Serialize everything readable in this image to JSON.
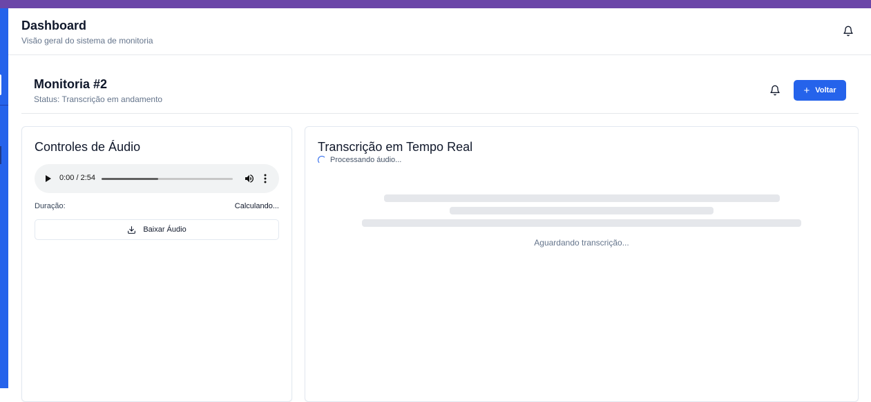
{
  "header": {
    "title": "Dashboard",
    "subtitle": "Visão geral do sistema de monitoria",
    "bell_icon": "bell-icon"
  },
  "page": {
    "title": "Monitoria #2",
    "status": "Status: Transcrição em andamento",
    "back_button": "Voltar",
    "back_button_icon": "plus-icon"
  },
  "audio_card": {
    "title": "Controles de Áudio",
    "player": {
      "time": "0:00 / 2:54",
      "progress_fraction": 0.43
    },
    "duration_label": "Duração:",
    "duration_value": "Calculando...",
    "download_button": "Baixar Áudio"
  },
  "transcription_card": {
    "title": "Transcrição em Tempo Real",
    "processing_text": "Processando áudio...",
    "waiting_text": "Aguardando transcrição..."
  },
  "colors": {
    "accent": "#2563eb",
    "topbar": "#6b46a8"
  }
}
